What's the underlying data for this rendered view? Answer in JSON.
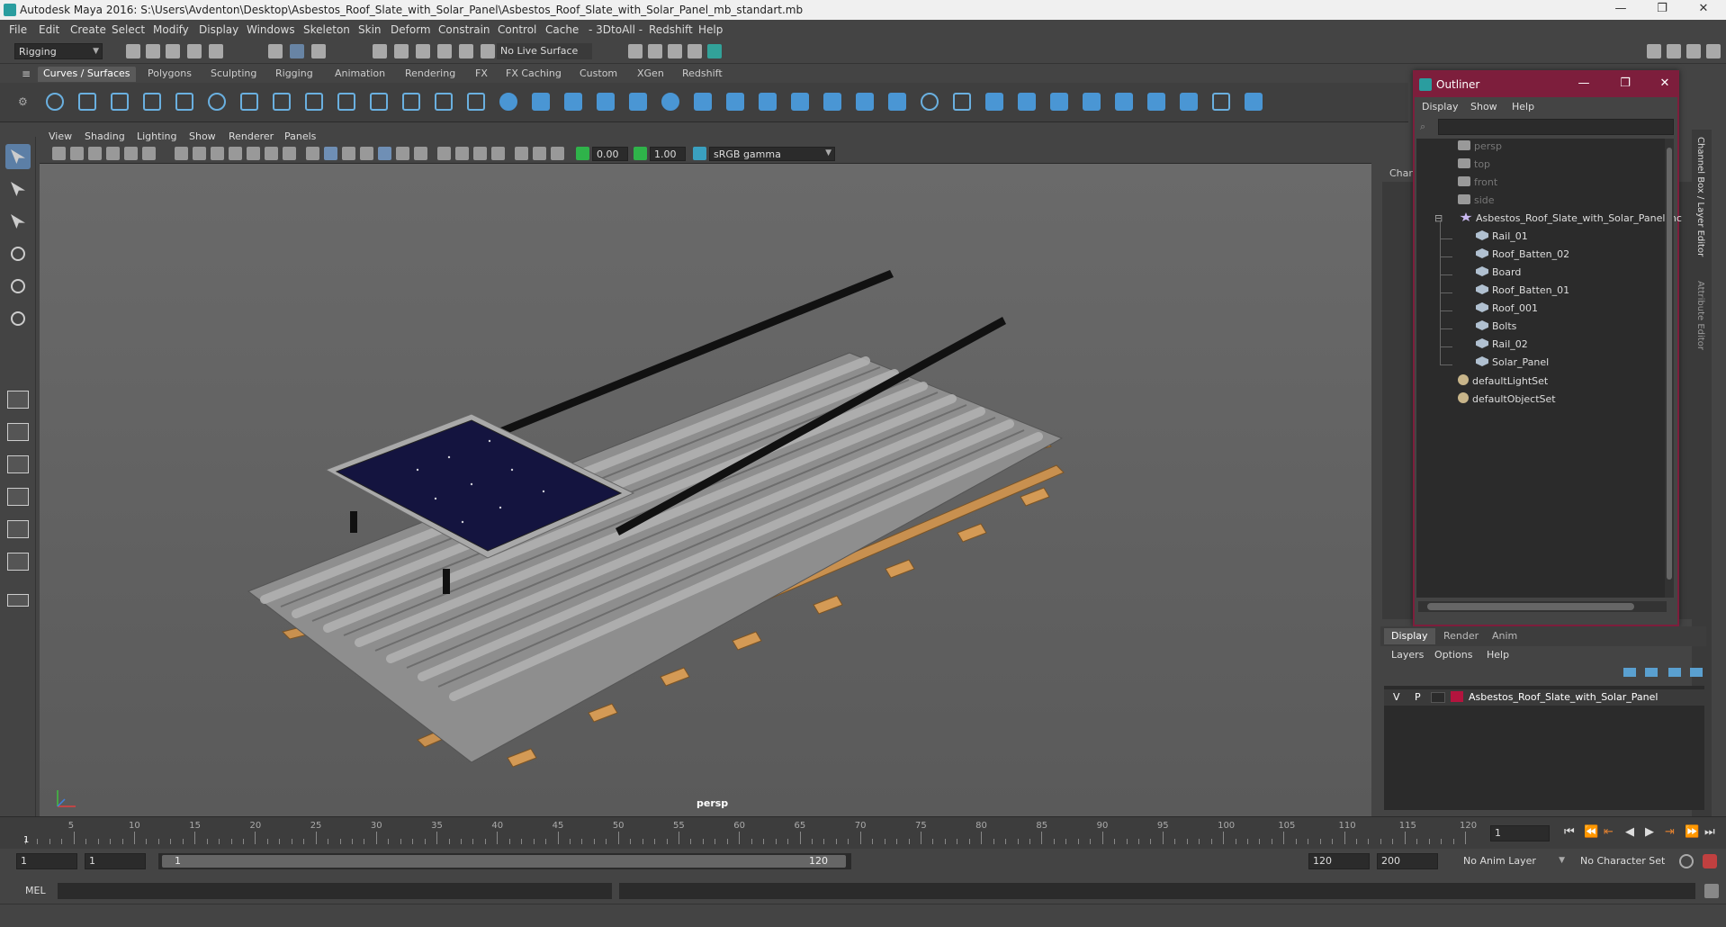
{
  "window": {
    "title": "Autodesk Maya 2016: S:\\Users\\Avdenton\\Desktop\\Asbestos_Roof_Slate_with_Solar_Panel\\Asbestos_Roof_Slate_with_Solar_Panel_mb_standart.mb",
    "minimize": "—",
    "maximize": "❐",
    "close": "✕"
  },
  "menubar": [
    "File",
    "Edit",
    "Create",
    "Select",
    "Modify",
    "Display",
    "Windows",
    "Skeleton",
    "Skin",
    "Deform",
    "Constrain",
    "Control",
    "Cache",
    "- 3DtoAll -",
    "Redshift",
    "Help"
  ],
  "statusline": {
    "mode": "Rigging",
    "live_surface": "No Live Surface"
  },
  "shelf_tabs": [
    "Curves / Surfaces",
    "Polygons",
    "Sculpting",
    "Rigging",
    "Animation",
    "Rendering",
    "FX",
    "FX Caching",
    "Custom",
    "XGen",
    "Redshift"
  ],
  "shelf_active": "Curves / Surfaces",
  "viewport": {
    "menu": [
      "View",
      "Shading",
      "Lighting",
      "Show",
      "Renderer",
      "Panels"
    ],
    "exposure": "0.00",
    "gamma": "1.00",
    "color_space": "sRGB gamma",
    "camera_label": "persp"
  },
  "outliner": {
    "title": "Outliner",
    "menu": [
      "Display",
      "Show",
      "Help"
    ],
    "items": [
      {
        "label": "persp",
        "type": "cam",
        "dim": true,
        "depth": 0
      },
      {
        "label": "top",
        "type": "cam",
        "dim": true,
        "depth": 0
      },
      {
        "label": "front",
        "type": "cam",
        "dim": true,
        "depth": 0
      },
      {
        "label": "side",
        "type": "cam",
        "dim": true,
        "depth": 0
      },
      {
        "label": "Asbestos_Roof_Slate_with_Solar_Panel_nc",
        "type": "grp",
        "dim": false,
        "depth": 0
      },
      {
        "label": "Rail_01",
        "type": "mesh",
        "dim": false,
        "depth": 1
      },
      {
        "label": "Roof_Batten_02",
        "type": "mesh",
        "dim": false,
        "depth": 1
      },
      {
        "label": "Board",
        "type": "mesh",
        "dim": false,
        "depth": 1
      },
      {
        "label": "Roof_Batten_01",
        "type": "mesh",
        "dim": false,
        "depth": 1
      },
      {
        "label": "Roof_001",
        "type": "mesh",
        "dim": false,
        "depth": 1
      },
      {
        "label": "Bolts",
        "type": "mesh",
        "dim": false,
        "depth": 1
      },
      {
        "label": "Rail_02",
        "type": "mesh",
        "dim": false,
        "depth": 1
      },
      {
        "label": "Solar_Panel",
        "type": "mesh",
        "dim": false,
        "depth": 1
      },
      {
        "label": "defaultLightSet",
        "type": "set",
        "dim": false,
        "depth": 0
      },
      {
        "label": "defaultObjectSet",
        "type": "set",
        "dim": false,
        "depth": 0
      }
    ]
  },
  "channel_box_label": "Chann",
  "side_tabs": [
    "Channel Box / Layer Editor",
    "Attribute Editor"
  ],
  "layer_editor": {
    "tabs": [
      "Display",
      "Render",
      "Anim"
    ],
    "menu": [
      "Layers",
      "Options",
      "Help"
    ],
    "layer": {
      "v": "V",
      "p": "P",
      "name": "Asbestos_Roof_Slate_with_Solar_Panel",
      "color": "#b3143e"
    }
  },
  "timeline": {
    "labels": [
      "5",
      "10",
      "15",
      "20",
      "25",
      "30",
      "35",
      "40",
      "45",
      "50",
      "55",
      "60",
      "65",
      "70",
      "75",
      "80",
      "85",
      "90",
      "95",
      "100",
      "105",
      "110",
      "115",
      "120"
    ],
    "start_marker": "1",
    "current_frame": "1"
  },
  "range": {
    "start": "1",
    "playback_start": "1",
    "slider_start": "1",
    "slider_end": "120",
    "playback_end": "120",
    "end": "200",
    "anim_layer": "No Anim Layer",
    "character_set": "No Character Set"
  },
  "cmdline": {
    "label": "MEL"
  }
}
